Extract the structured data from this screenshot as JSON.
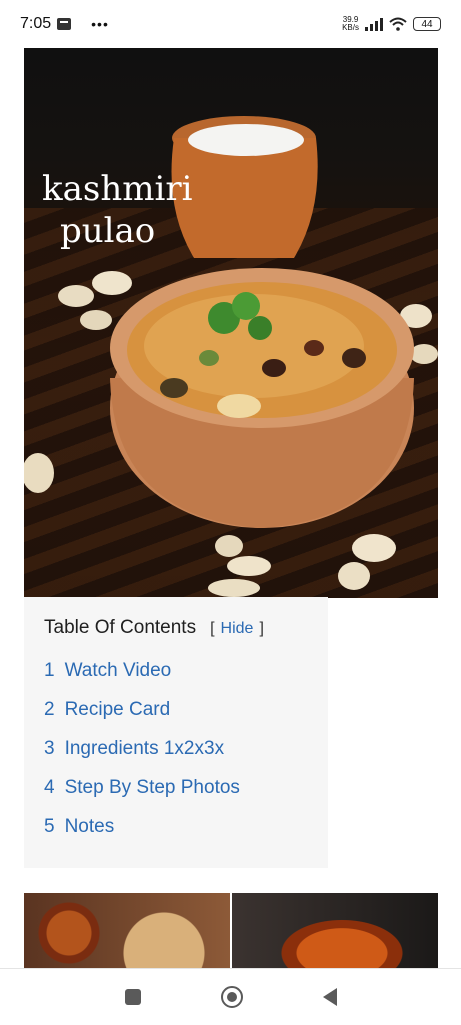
{
  "status_bar": {
    "time": "7:05",
    "network_speed_value": "39.9",
    "network_speed_unit": "KB/s",
    "battery": "44"
  },
  "hero": {
    "title_line1": "kashmiri",
    "title_line2": "pulao"
  },
  "toc": {
    "title": "Table Of Contents",
    "toggle_open": "[",
    "toggle_label": "Hide",
    "toggle_close": "]",
    "items": [
      {
        "num": "1",
        "label": "Watch Video"
      },
      {
        "num": "2",
        "label": "Recipe Card"
      },
      {
        "num": "3",
        "label": "Ingredients 1x2x3x"
      },
      {
        "num": "4",
        "label": "Step By Step Photos"
      },
      {
        "num": "5",
        "label": "Notes"
      }
    ]
  },
  "nav": {
    "recents_icon": "square-icon",
    "home_icon": "circle-home-icon",
    "back_icon": "triangle-back-icon"
  }
}
